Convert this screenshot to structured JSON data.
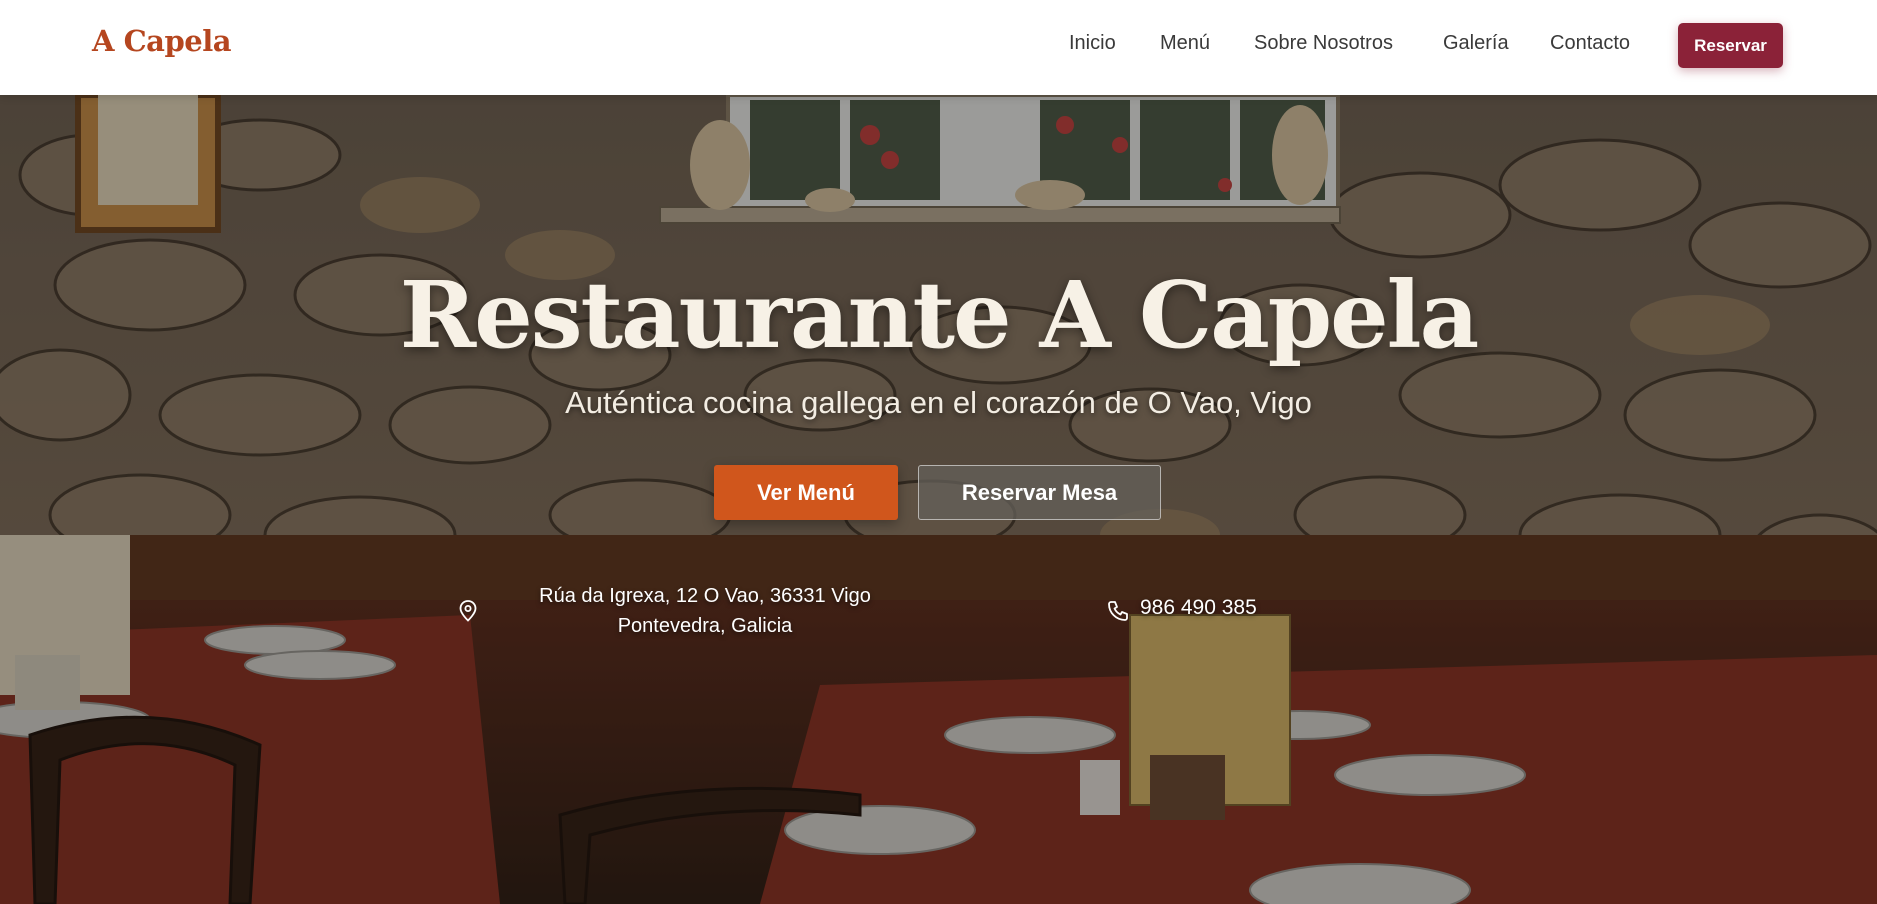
{
  "header": {
    "logo": "A Capela",
    "nav": [
      "Inicio",
      "Menú",
      "Sobre Nosotros",
      "Galería",
      "Contacto"
    ],
    "reserve_button": "Reservar"
  },
  "hero": {
    "title": "Restaurante A Capela",
    "subtitle": "Auténtica cocina gallega en el corazón de O Vao, Vigo",
    "primary_button": "Ver Menú",
    "secondary_button": "Reservar Mesa",
    "address_line1": "Rúa da Igrexa, 12 O Vao, 36331 Vigo",
    "address_line2": "Pontevedra, Galicia",
    "phone": "986 490 385",
    "address_icon": "map-pin-icon",
    "phone_icon": "phone-icon"
  },
  "colors": {
    "brand": "#b5461f",
    "accent_button": "#d0561c",
    "reserve_button": "#8b2238"
  }
}
